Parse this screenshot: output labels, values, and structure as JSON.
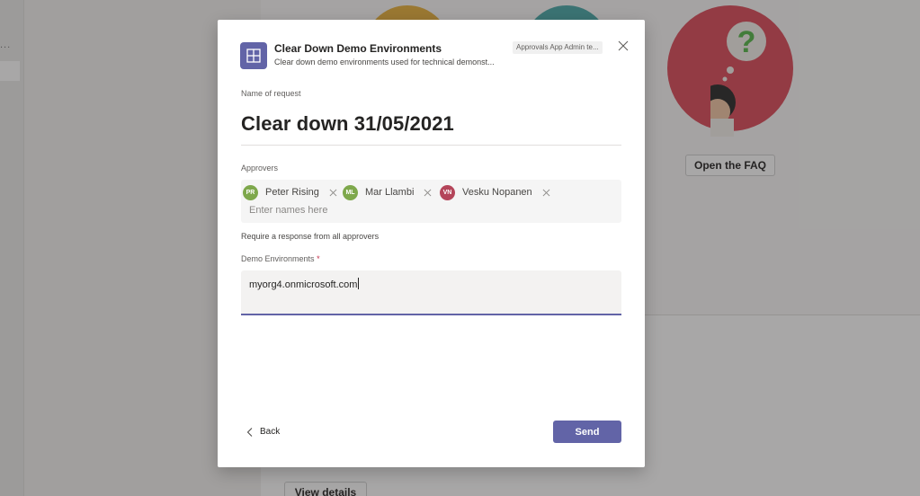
{
  "background": {
    "faq_button": "Open the FAQ",
    "view_details_button": "View details",
    "dots": "..."
  },
  "dialog": {
    "title": "Clear Down Demo Environments",
    "subtitle": "Clear down demo environments used for technical demonst...",
    "badge": "Approvals App Admin te...",
    "close_icon": "close-icon",
    "app_icon": "approvals-app-icon",
    "name_label": "Name of request",
    "request_name": "Clear down 31/05/2021",
    "approvers_label": "Approvers",
    "approvers": [
      {
        "initials": "PR",
        "name": "Peter Rising",
        "color": "#7ea84c"
      },
      {
        "initials": "ML",
        "name": "Mar Llambi",
        "color": "#7ea84c"
      },
      {
        "initials": "VN",
        "name": "Vesku Nopanen",
        "color": "#b4455a"
      }
    ],
    "names_placeholder": "Enter names here",
    "require_text": "Require a response from all approvers",
    "env_label": "Demo Environments",
    "required_mark": "*",
    "env_value": "myorg4.onmicrosoft.com",
    "back_label": "Back",
    "send_label": "Send"
  },
  "colors": {
    "accent": "#6264a7",
    "required": "#c4314b"
  }
}
